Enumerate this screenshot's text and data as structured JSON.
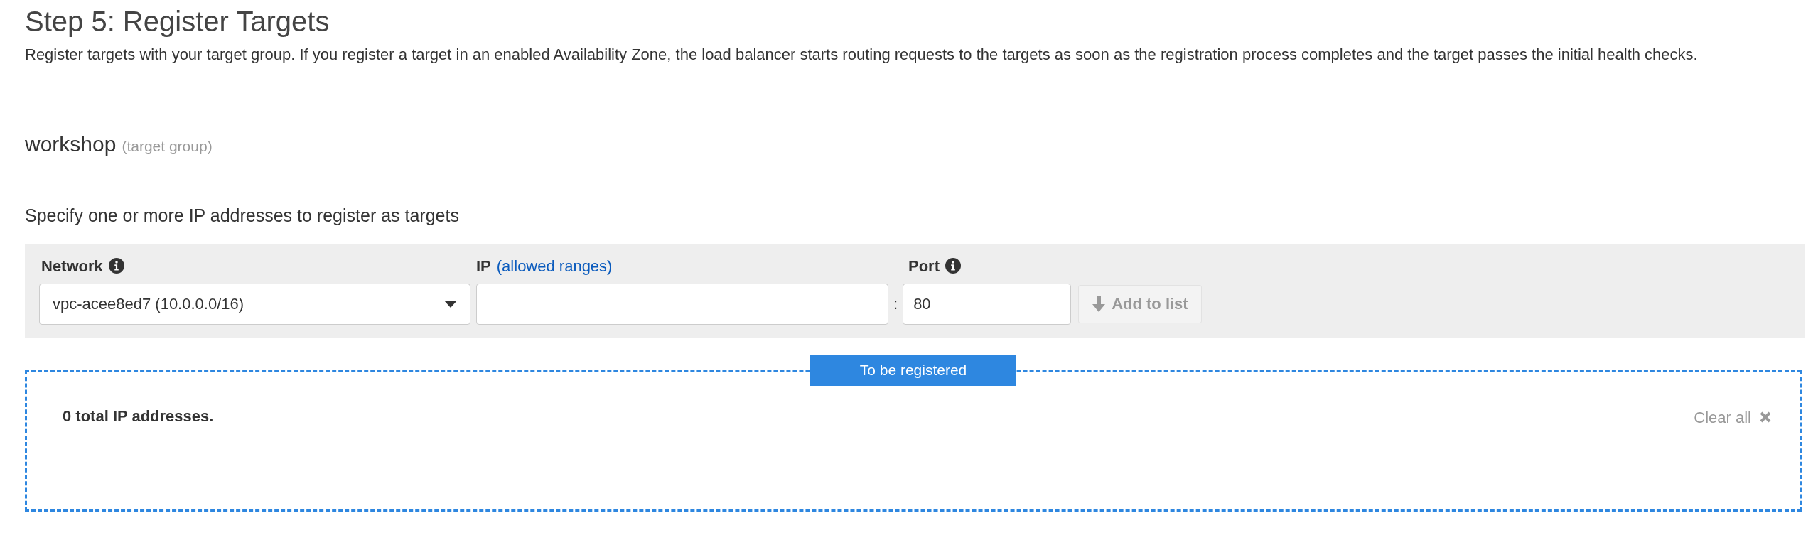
{
  "heading": "Step 5: Register Targets",
  "description": "Register targets with your target group. If you register a target in an enabled Availability Zone, the load balancer starts routing requests to the targets as soon as the registration process completes and the target passes the initial health checks.",
  "target_group": {
    "name": "workshop",
    "suffix": "(target group)"
  },
  "instruction": "Specify one or more IP addresses to register as targets",
  "form": {
    "network": {
      "label": "Network",
      "value": "vpc-acee8ed7 (10.0.0.0/16)"
    },
    "ip": {
      "label": "IP",
      "link": "(allowed ranges)"
    },
    "separator": ":",
    "port": {
      "label": "Port",
      "value": "80"
    },
    "add_button": {
      "label": "Add to list",
      "disabled": true
    }
  },
  "registered": {
    "badge": "To be registered",
    "count": "0 total IP addresses.",
    "clear": "Clear all"
  }
}
